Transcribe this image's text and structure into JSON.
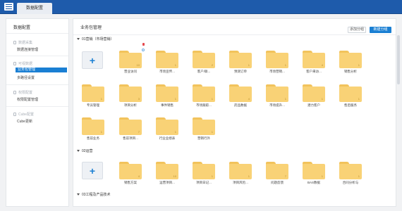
{
  "topbar": {
    "app_tab": "数据配置"
  },
  "sidebar": {
    "title": "数据配置",
    "groups": [
      {
        "label": "数据采集",
        "items": [
          {
            "label": "数据连接管理",
            "active": false
          }
        ]
      },
      {
        "label": "可视数据",
        "items": [
          {
            "label": "业务包管理",
            "active": true
          },
          {
            "label": "多路径设置",
            "active": false
          }
        ]
      },
      {
        "label": "权限配置",
        "items": [
          {
            "label": "权限配置管理",
            "active": false
          }
        ]
      },
      {
        "label": "Cube配置",
        "items": [
          {
            "label": "Cube更新",
            "active": false
          }
        ]
      }
    ]
  },
  "main": {
    "title": "业务包管理",
    "add_group_button": "添加分组",
    "new_group_button": "新建分组",
    "sections": [
      {
        "label": "01营销（市场营销）",
        "folders": [
          {
            "name": "营业访问",
            "count": "10"
          },
          {
            "name": "市场宣传...",
            "count": "1"
          },
          {
            "name": "客户/联...",
            "count": "2"
          },
          {
            "name": "预测订单",
            "count": "1"
          },
          {
            "name": "市场营销...",
            "count": "1"
          },
          {
            "name": "客户来访...",
            "count": "4"
          },
          {
            "name": "销售分析",
            "count": "1"
          },
          {
            "name": "专员管理",
            "count": "1"
          },
          {
            "name": "项目分析",
            "count": "3"
          },
          {
            "name": "事件销售",
            "count": "1"
          },
          {
            "name": "市场跟踪...",
            "count": "1"
          },
          {
            "name": "药品数据",
            "count": "4"
          },
          {
            "name": "市场提升...",
            "count": "1"
          },
          {
            "name": "潜力客户",
            "count": "1"
          },
          {
            "name": "售后服务",
            "count": "1"
          },
          {
            "name": "售前业务",
            "count": "1"
          },
          {
            "name": "售前项目...",
            "count": "7"
          },
          {
            "name": "行业业绩表",
            "count": "1"
          },
          {
            "name": "营销行外",
            "count": "1"
          }
        ]
      },
      {
        "label": "02运营",
        "folders": [
          {
            "name": "销售方案",
            "count": "4"
          },
          {
            "name": "运营项目...",
            "count": "10"
          },
          {
            "name": "项目日记...",
            "count": "1"
          },
          {
            "name": "项目风险...",
            "count": "1"
          },
          {
            "name": "问题反馈",
            "count": "7"
          },
          {
            "name": "BAS数据",
            "count": "1"
          },
          {
            "name": "合同分析与",
            "count": "1"
          }
        ]
      },
      {
        "label": "03工程及产品技术",
        "folders": []
      }
    ]
  },
  "colors": {
    "accent": "#1a7fd3",
    "topbar": "#1e5bab",
    "folder": "#f9d276",
    "folder_tab": "#f2c35c"
  }
}
